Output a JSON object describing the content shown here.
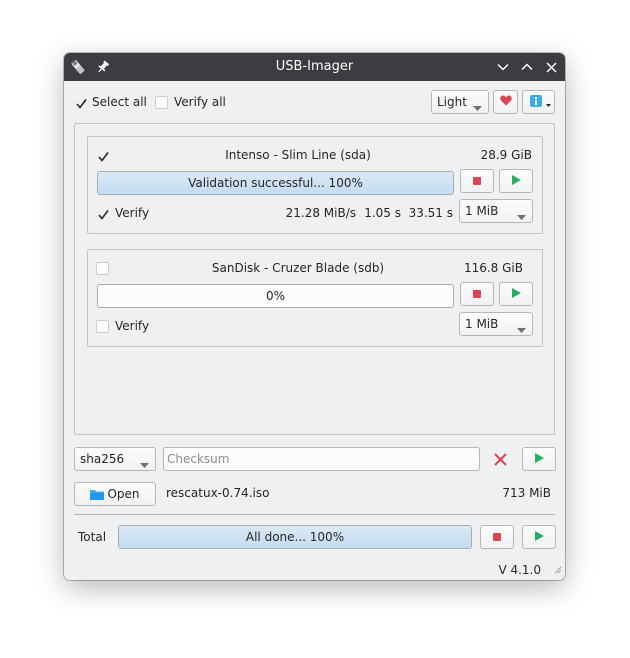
{
  "window": {
    "title": "USB-Imager"
  },
  "toolbar": {
    "select_all": {
      "label": "Select all",
      "checked": true
    },
    "verify_all": {
      "label": "Verify all",
      "checked": false
    },
    "theme": "Light"
  },
  "devices": [
    {
      "checked": true,
      "name": "Intenso - Slim Line (sda)",
      "size": "28.9 GiB",
      "progress_text": "Validation successful... 100%",
      "progress": 100,
      "verify": {
        "label": "Verify",
        "checked": true
      },
      "speed": "21.28 MiB/s",
      "time1": "1.05 s",
      "time2": "33.51 s",
      "buffer": "1 MiB"
    },
    {
      "checked": false,
      "name": "SanDisk - Cruzer Blade (sdb)",
      "size": "116.8 GiB",
      "progress_text": "0%",
      "progress": 0,
      "verify": {
        "label": "Verify",
        "checked": false
      },
      "buffer": "1 MiB"
    }
  ],
  "checksum": {
    "algorithm": "sha256",
    "placeholder": "Checksum",
    "value": ""
  },
  "file": {
    "open_label": "Open",
    "name": "rescatux-0.74.iso",
    "size": "713 MiB"
  },
  "total": {
    "label": "Total",
    "progress_text": "All done... 100%",
    "progress": 100
  },
  "version": "V 4.1.0",
  "colors": {
    "accent": "#3daee9",
    "stop": "#da4453",
    "play": "#27ae60",
    "titlebar": "#3b3d40",
    "progress_fill": "#c3dcf1"
  },
  "icons": [
    "usb-drive-icon",
    "pin-icon",
    "minimize-icon",
    "maximize-icon",
    "close-icon",
    "heart-icon",
    "info-icon",
    "stop-icon",
    "play-icon",
    "clear-icon",
    "folder-icon"
  ]
}
